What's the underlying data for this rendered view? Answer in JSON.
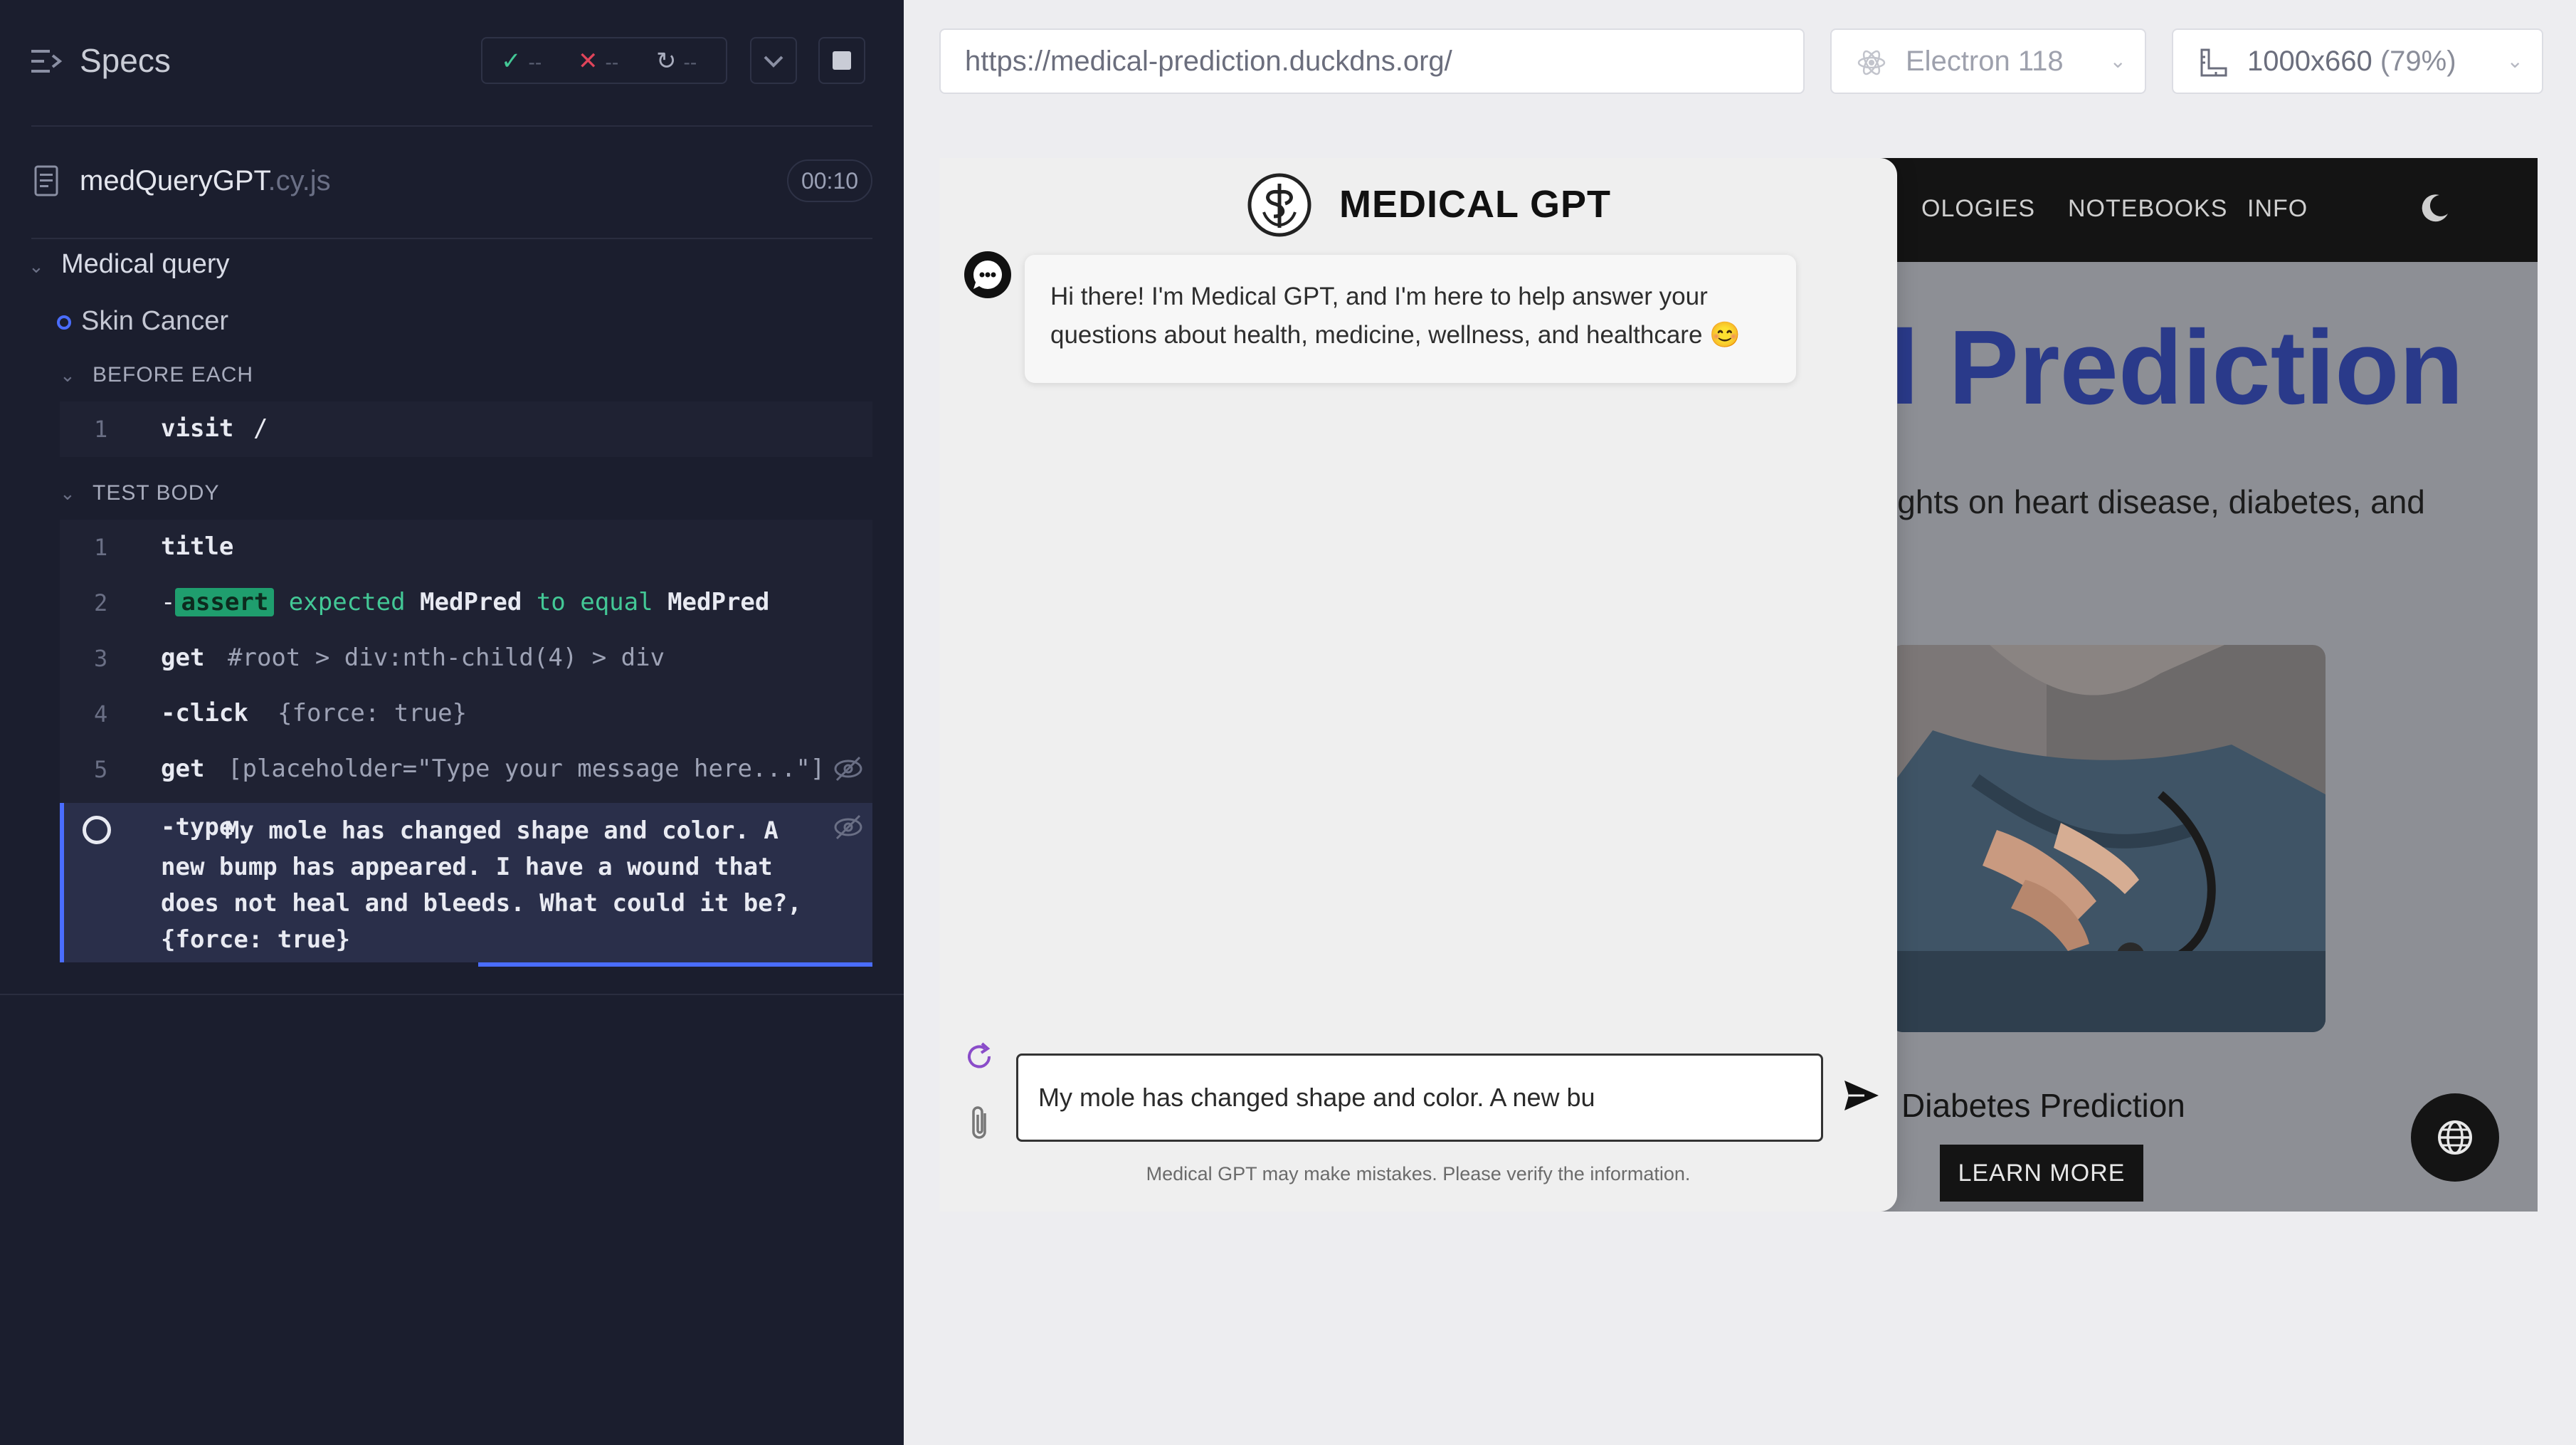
{
  "reporter": {
    "title": "Specs",
    "stats": {
      "passed": "--",
      "failed": "--",
      "pending": "--"
    },
    "spec_file": {
      "name": "medQueryGPT",
      "ext": ".cy.js",
      "duration": "00:10"
    },
    "suite": "Medical query",
    "test": "Skin Cancer",
    "before_each": {
      "label": "BEFORE EACH",
      "commands": [
        {
          "num": "1",
          "name": "visit",
          "message": "/"
        }
      ]
    },
    "test_body": {
      "label": "TEST BODY",
      "commands": [
        {
          "num": "1",
          "name": "title",
          "message": ""
        },
        {
          "num": "2",
          "name": "-assert",
          "message": "expected MedPred to equal MedPred"
        },
        {
          "num": "3",
          "name": "get",
          "message": "#root > div:nth-child(4) > div"
        },
        {
          "num": "4",
          "name": "-click",
          "message": "{force: true}"
        },
        {
          "num": "5",
          "name": "get",
          "message": "[placeholder=\"Type your message here...\"]"
        },
        {
          "num": "",
          "name": "-type",
          "message": "My mole has changed shape and color. A new bump has appeared. I have a wound that does not heal and bleeds. What could it be?, {force: true}"
        }
      ]
    },
    "assert_parts": {
      "badge": "assert",
      "expected": "expected",
      "value1": "MedPred",
      "to_equal": "to equal",
      "value2": "MedPred"
    },
    "active_text_lines": [
      "My mole has changed shape and color. A",
      "new bump has appeared. I have a wound that",
      "does not heal and bleeds. What could it be?,",
      "{force: true}"
    ],
    "colors": {
      "accent": "#4a6dff",
      "pass": "#43c896",
      "fail": "#e0445a",
      "bg": "#1b1e2e"
    },
    "icons": [
      "specs-icon",
      "check-icon",
      "x-icon",
      "pending-icon",
      "chevron-down-icon",
      "stop-icon",
      "file-icon",
      "eye-off-icon",
      "spinner-icon"
    ]
  },
  "browser": {
    "url": "https://medical-prediction.duckdns.org/",
    "browser_name": "Electron 118",
    "viewport": "1000x660",
    "zoom": "(79%)"
  },
  "app": {
    "nav_items": [
      "OLOGIES",
      "NOTEBOOKS",
      "INFO"
    ],
    "hero_title": "l Prediction",
    "hero_subtitle": "ights on heart disease, diabetes, and",
    "card_title": "Diabetes Prediction",
    "learn_more": "LEARN MORE",
    "chat": {
      "title": "MEDICAL GPT",
      "greeting": "Hi there! I'm Medical GPT, and I'm here to help answer your questions about health, medicine, wellness, and healthcare 😊",
      "input_value": "My mole has changed shape and color. A new bu",
      "input_placeholder": "Type your message here...",
      "disclaimer": "Medical GPT may make mistakes. Please verify the information."
    },
    "icons": [
      "moon-icon",
      "globe-icon",
      "medical-logo-icon",
      "bot-icon",
      "refresh-icon",
      "paperclip-icon",
      "send-icon"
    ]
  }
}
